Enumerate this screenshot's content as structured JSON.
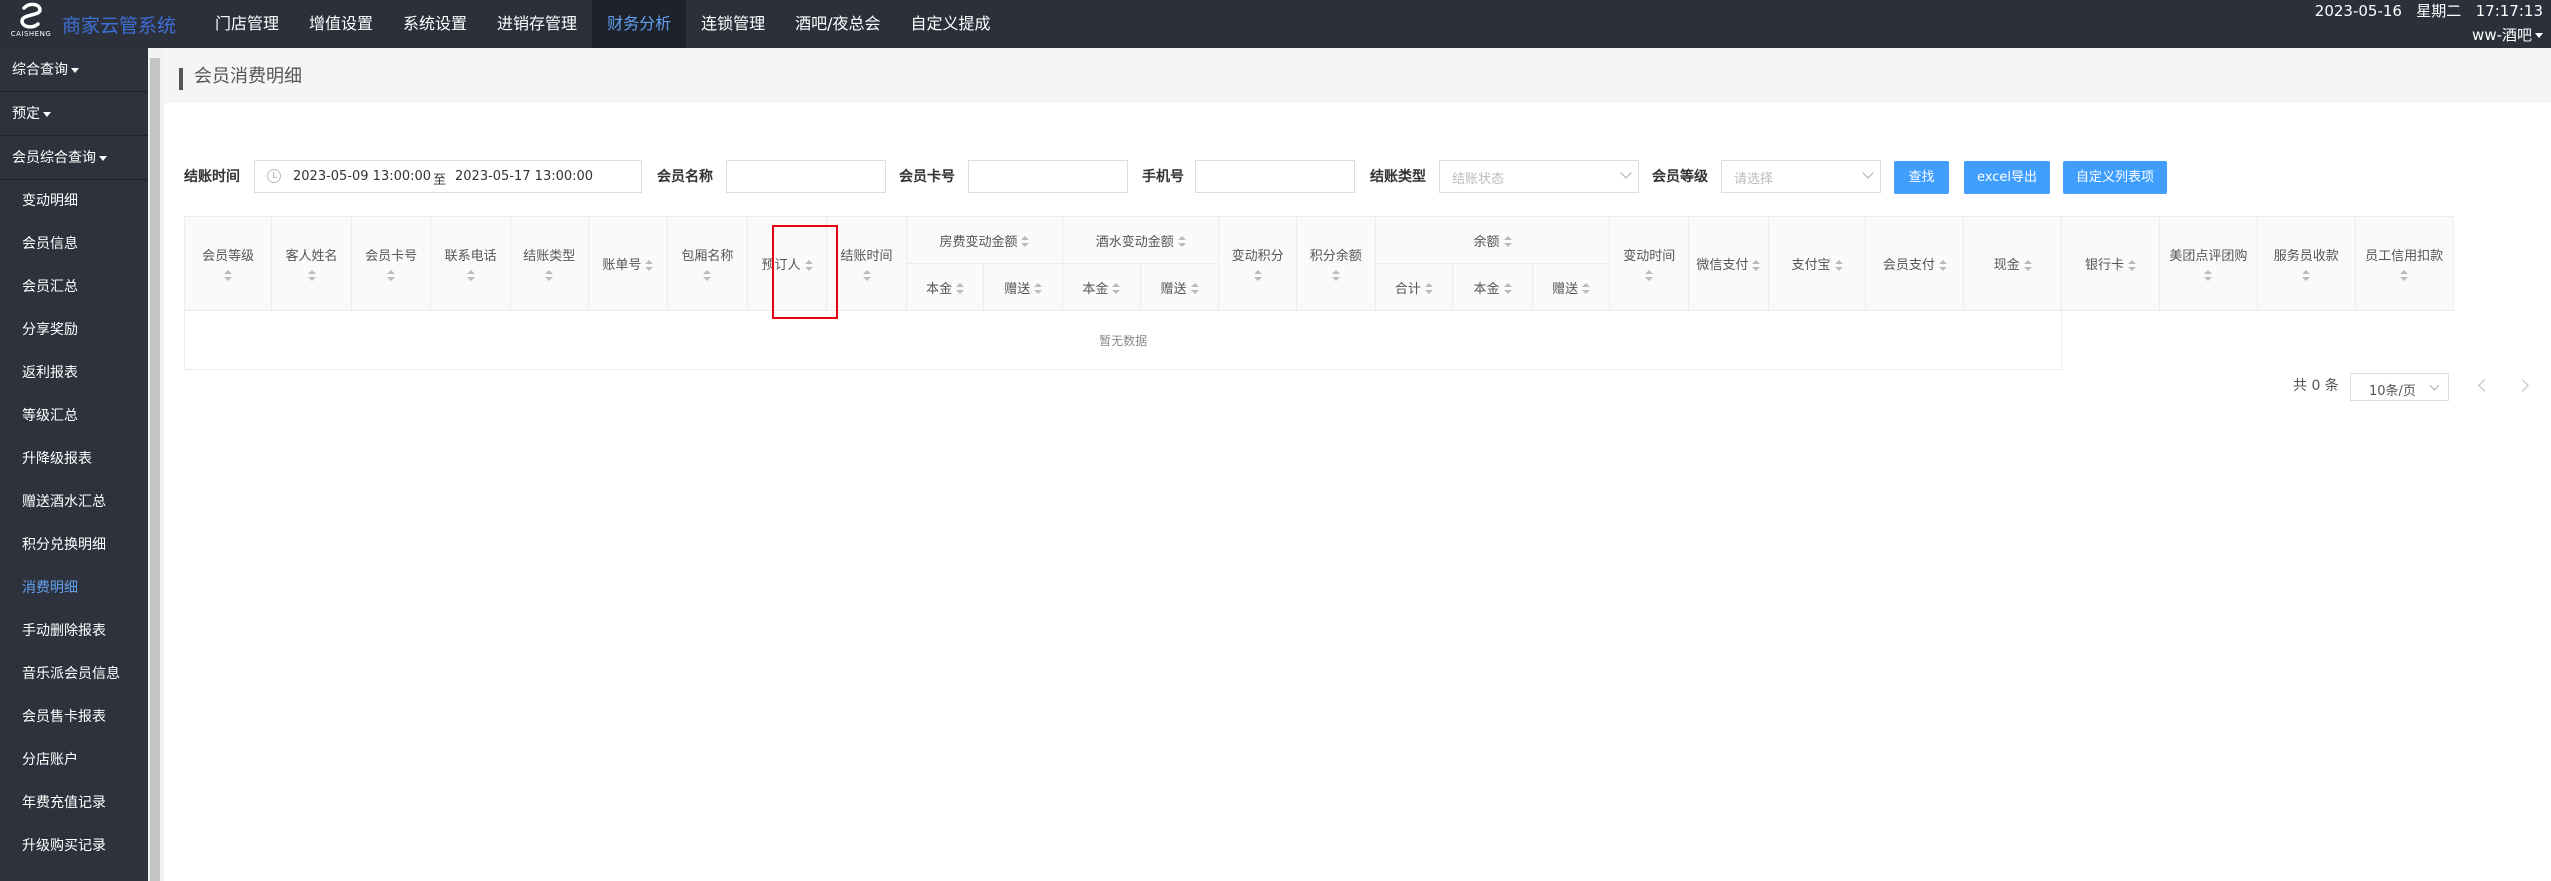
{
  "header": {
    "logo_text": "CAISHENG",
    "brand": "商家云管系统",
    "nav": [
      "门店管理",
      "增值设置",
      "系统设置",
      "进销存管理",
      "财务分析",
      "连锁管理",
      "酒吧/夜总会",
      "自定义提成"
    ],
    "active_nav": "财务分析",
    "date": "2023-05-16",
    "weekday": "星期二",
    "time": "17:17:13",
    "user": "ww-酒吧"
  },
  "sidebar": {
    "groups": [
      "综合查询",
      "预定",
      "会员综合查询"
    ],
    "items": [
      "变动明细",
      "会员信息",
      "会员汇总",
      "分享奖励",
      "返利报表",
      "等级汇总",
      "升降级报表",
      "赠送酒水汇总",
      "积分兑换明细",
      "消费明细",
      "手动删除报表",
      "音乐派会员信息",
      "会员售卡报表",
      "分店账户",
      "年费充值记录",
      "升级购买记录"
    ],
    "active_item": "消费明细"
  },
  "page": {
    "title": "会员消费明细"
  },
  "filters": {
    "checkout_time_label": "结账时间",
    "date_start": "2023-05-09 13:00:00",
    "date_sep": "至",
    "date_end": "2023-05-17 13:00:00",
    "member_name_label": "会员名称",
    "member_card_label": "会员卡号",
    "phone_label": "手机号",
    "checkout_type_label": "结账类型",
    "checkout_type_placeholder": "结账状态",
    "member_level_label": "会员等级",
    "member_level_placeholder": "请选择",
    "search_button": "查找",
    "excel_button": "excel导出",
    "custom_button": "自定义列表项"
  },
  "table": {
    "columns": [
      "会员等级",
      "客人姓名",
      "会员卡号",
      "联系电话",
      "结账类型",
      "账单号",
      "包厢名称",
      "预订人",
      "结账时间",
      "房费变动金额",
      "酒水变动金额",
      "变动积分",
      "积分余额",
      "余额",
      "变动时间",
      "微信支付",
      "支付宝",
      "会员支付",
      "现金",
      "银行卡",
      "美团点评团购",
      "服务员收款",
      "员工信用扣款"
    ],
    "sub_room": [
      "本金",
      "赠送"
    ],
    "sub_drink": [
      "本金",
      "赠送"
    ],
    "sub_balance": [
      "合计",
      "本金",
      "赠送"
    ],
    "empty_text": "暂无数据"
  },
  "pagination": {
    "total": "共 0 条",
    "page_size": "10条/页"
  },
  "colors": {
    "topbar": "#2b303b",
    "sidebar": "#2d323c",
    "accent": "#409eff",
    "highlight": "#e60012"
  }
}
